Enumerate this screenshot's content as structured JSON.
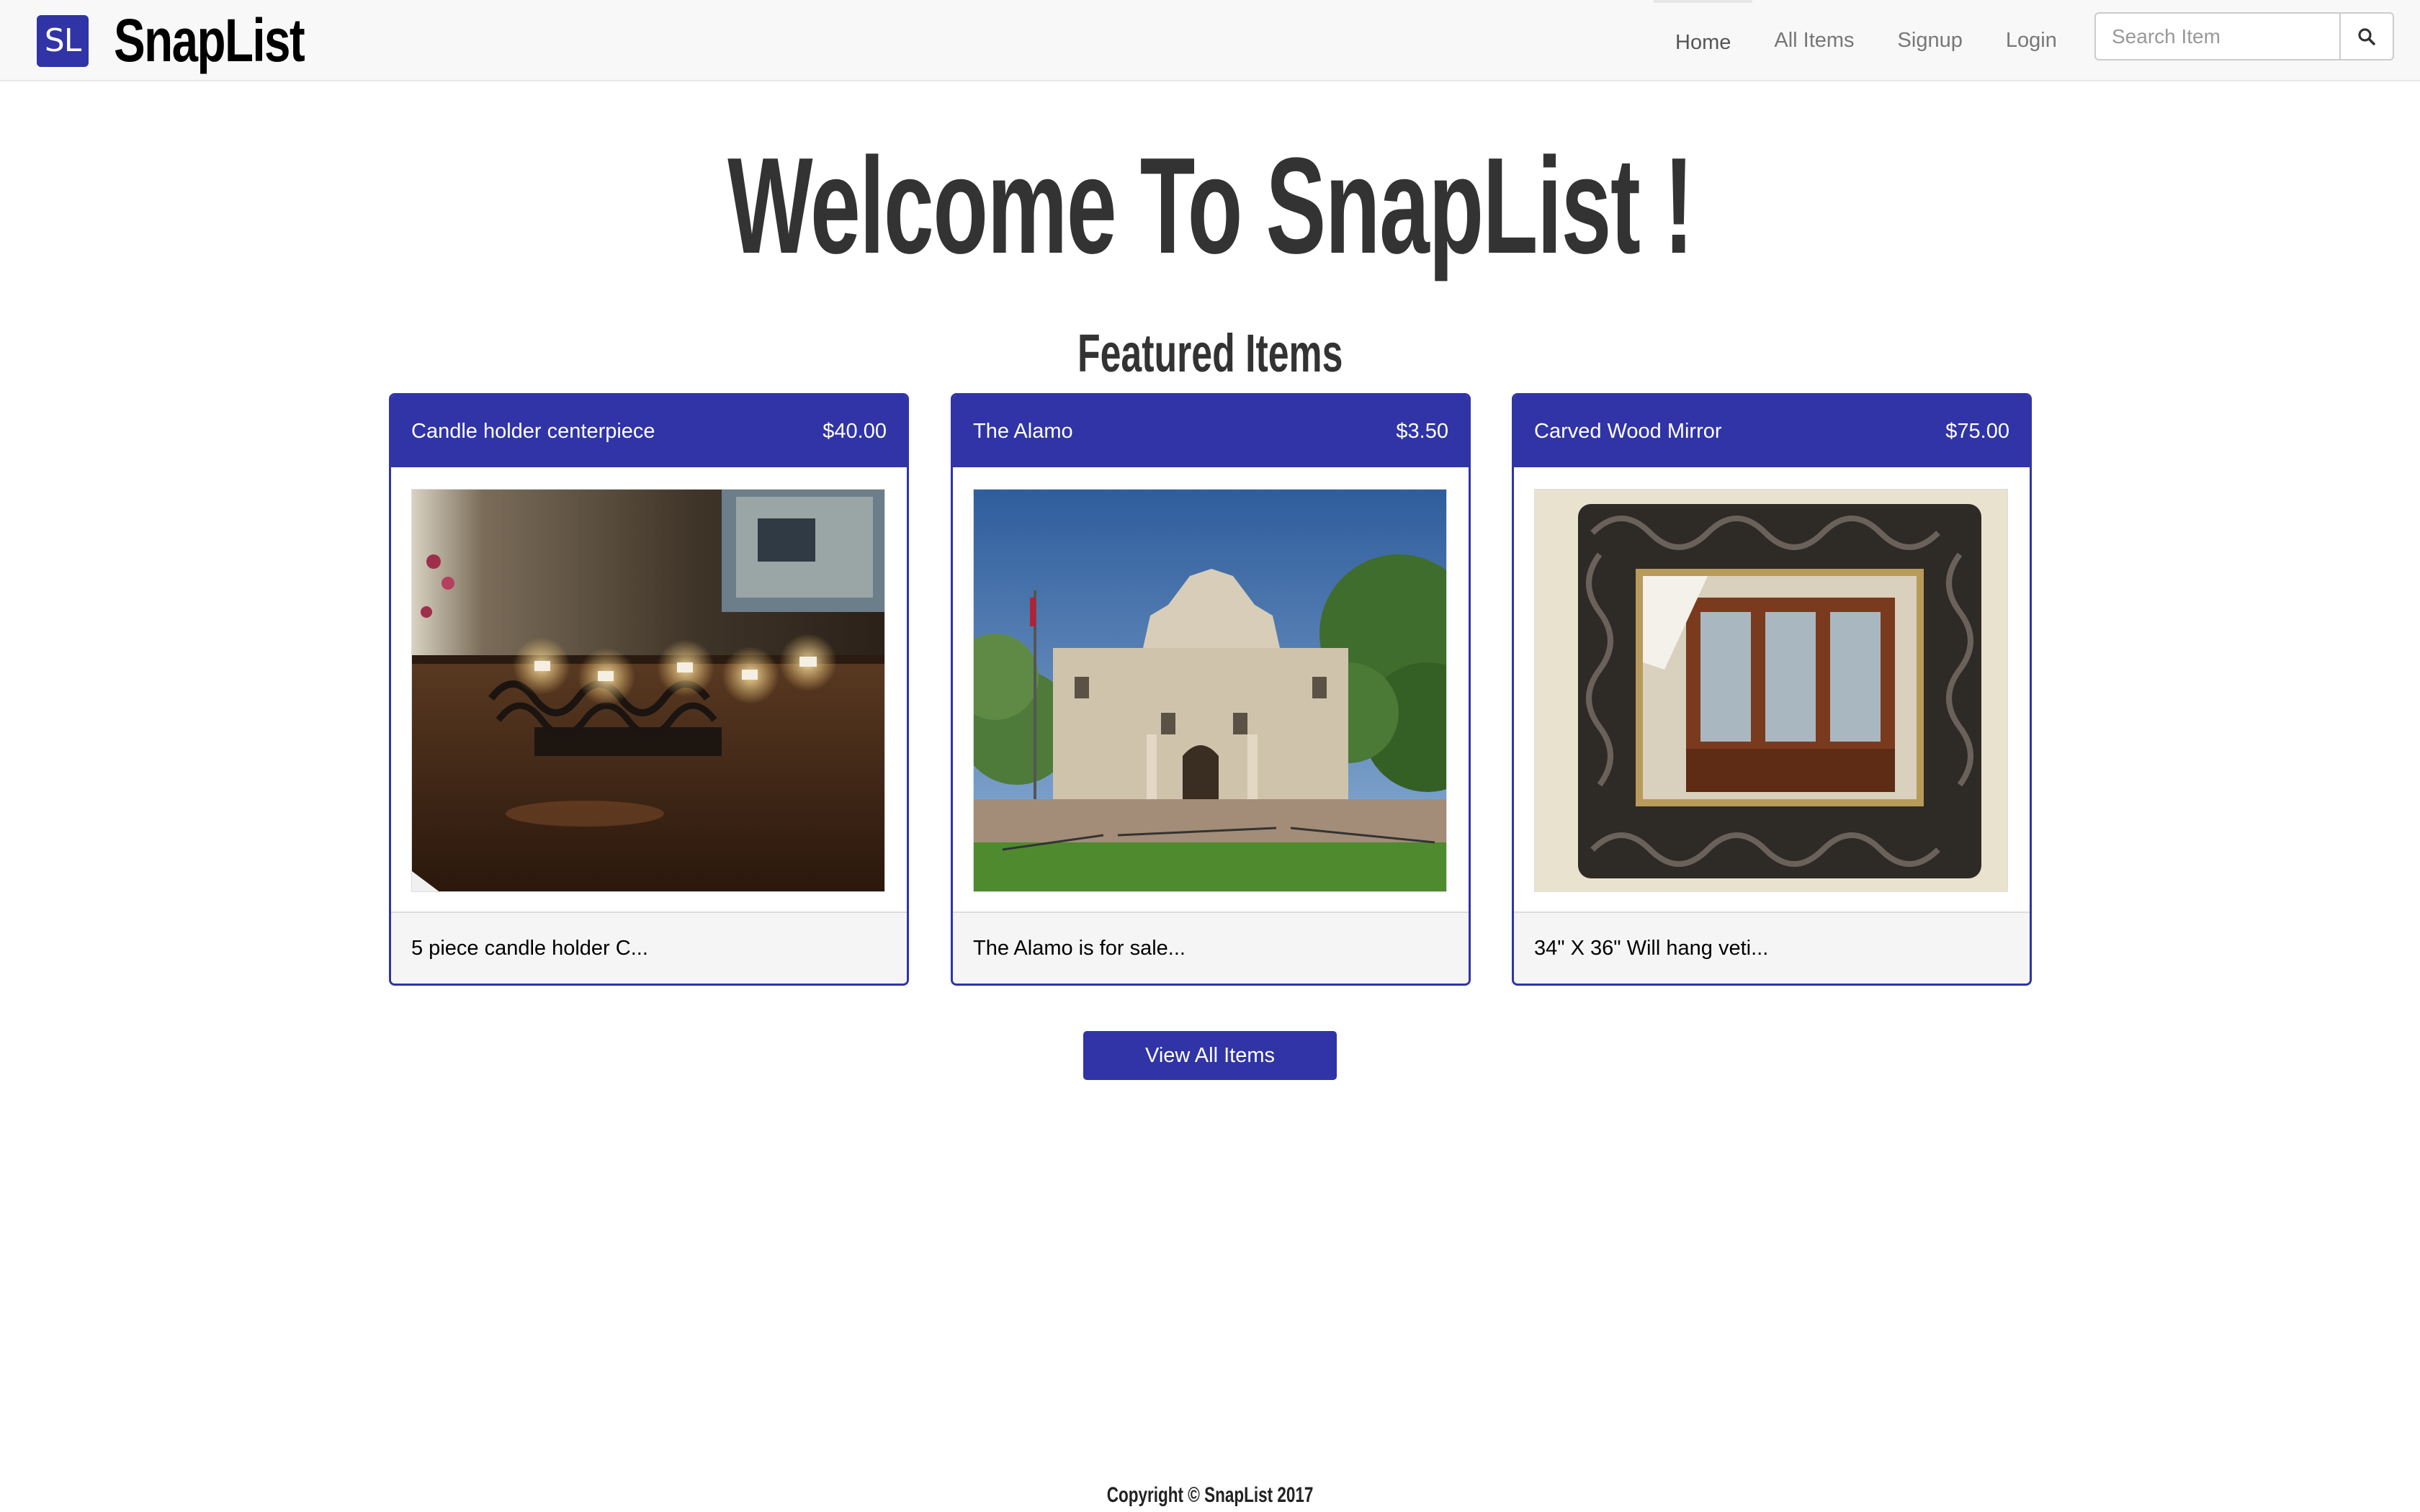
{
  "brand": {
    "logo_text": "SL",
    "name": "SnapList"
  },
  "nav": {
    "items": [
      {
        "label": "Home",
        "active": true
      },
      {
        "label": "All Items",
        "active": false
      },
      {
        "label": "Signup",
        "active": false
      },
      {
        "label": "Login",
        "active": false
      }
    ],
    "search": {
      "placeholder": "Search Item",
      "value": "",
      "button_icon": "search-icon"
    }
  },
  "main": {
    "title": "Welcome To SnapList !",
    "featured_title": "Featured Items",
    "items": [
      {
        "title": "Candle holder centerpiece",
        "price": "$40.00",
        "description": "5 piece candle holder C...",
        "image": "candle-holder-photo"
      },
      {
        "title": "The Alamo",
        "price": "$3.50",
        "description": "The Alamo is for sale...",
        "image": "alamo-photo"
      },
      {
        "title": "Carved Wood Mirror",
        "price": "$75.00",
        "description": "34\" X 36\" Will hang veti...",
        "image": "carved-mirror-photo"
      }
    ],
    "view_all_label": "View All Items"
  },
  "footer": {
    "copyright": "Copyright © SnapList 2017"
  },
  "colors": {
    "brand_primary": "#3034a6",
    "navbar_bg": "#f8f8f8",
    "heading": "#333333",
    "nav_text": "#777777"
  }
}
